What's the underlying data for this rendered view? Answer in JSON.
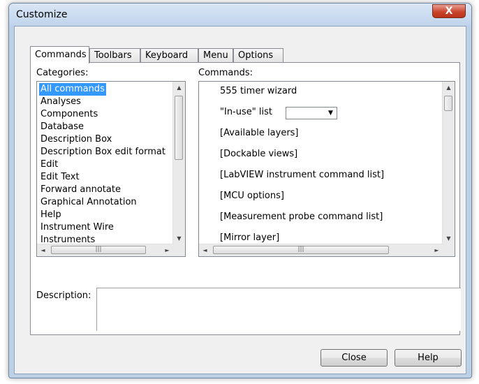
{
  "window": {
    "title": "Customize",
    "close_glyph": "X"
  },
  "tabs": [
    "Commands",
    "Toolbars",
    "Keyboard",
    "Menu",
    "Options"
  ],
  "categories": {
    "label": "Categories:",
    "items": [
      "All commands",
      "Analyses",
      "Components",
      "Database",
      "Description Box",
      "Description Box edit format",
      "Edit",
      "Edit Text",
      "Forward annotate",
      "Graphical Annotation",
      "Help",
      "Instrument Wire",
      "Instruments"
    ],
    "selected": "All commands"
  },
  "commands": {
    "label": "Commands:",
    "items": [
      "555 timer wizard",
      "\"In-use\" list",
      "[Available layers]",
      "[Dockable views]",
      "[LabVIEW instrument command list]",
      "[MCU options]",
      "[Measurement probe command list]",
      "[Mirror layer]"
    ]
  },
  "description": {
    "label": "Description:",
    "value": ""
  },
  "buttons": {
    "close": "Close",
    "help": "Help"
  },
  "glyphs": {
    "up": "▲",
    "down": "▼",
    "left": "◄",
    "right": "►",
    "grip": "|||"
  }
}
